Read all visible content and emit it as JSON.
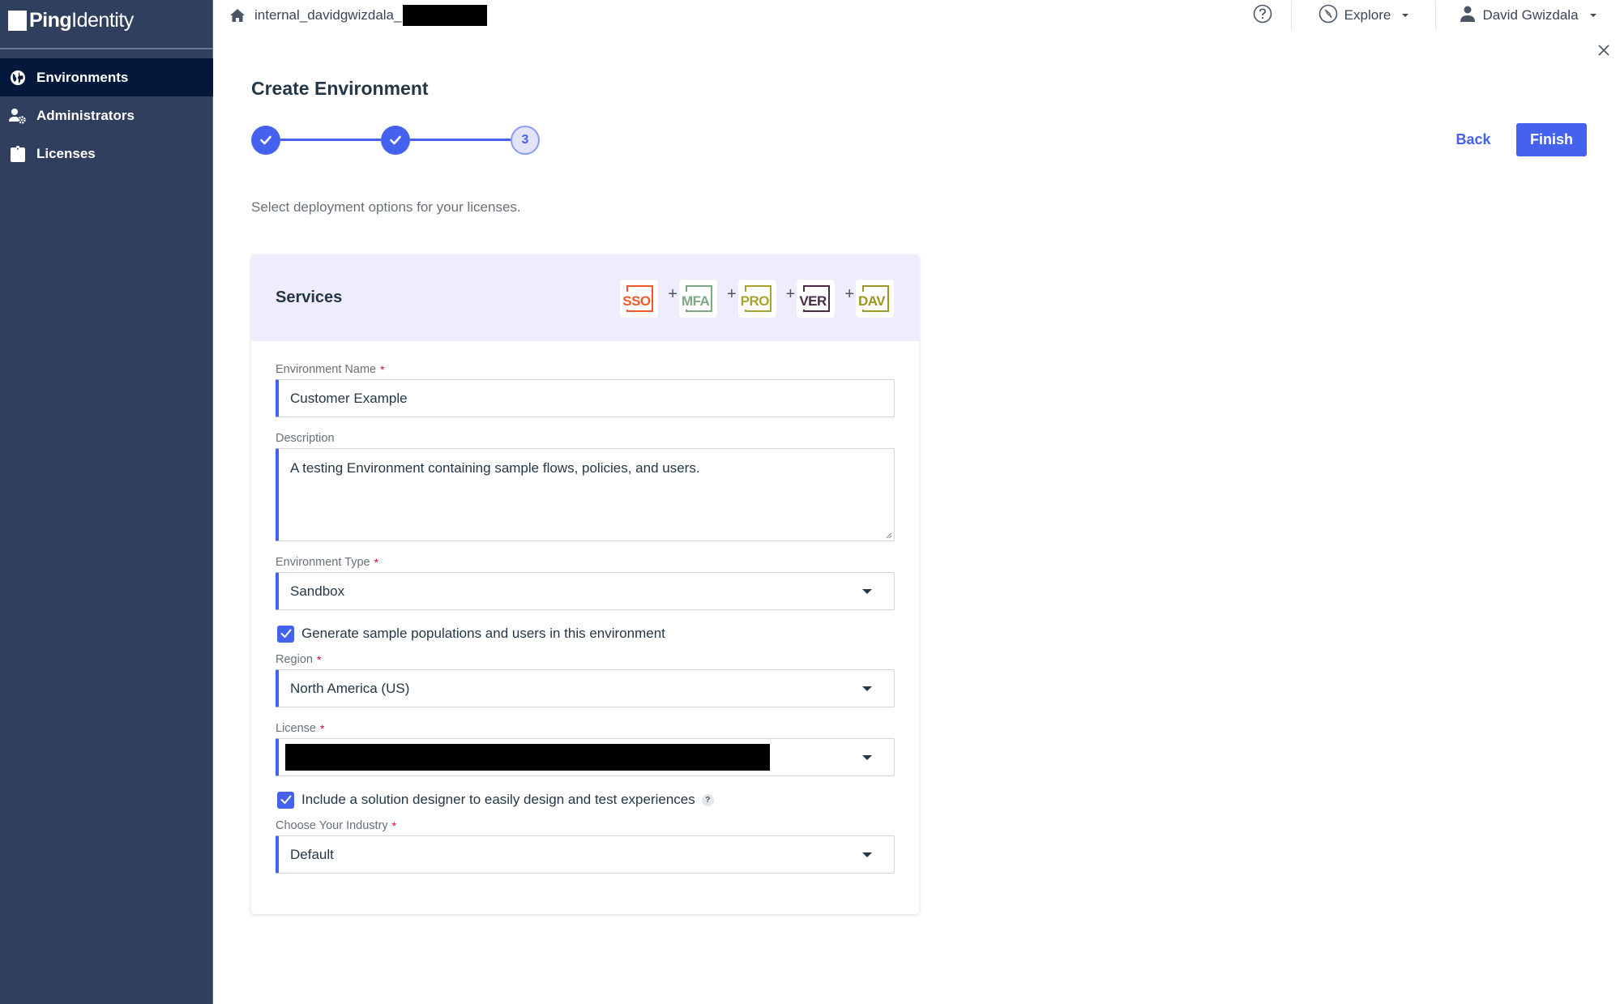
{
  "brand": {
    "logo_bold": "Ping",
    "logo_light": "Identity"
  },
  "sidebar": {
    "items": [
      {
        "label": "Environments",
        "icon": "globe-icon",
        "active": true
      },
      {
        "label": "Administrators",
        "icon": "user-gear-icon",
        "active": false
      },
      {
        "label": "Licenses",
        "icon": "clipboard-icon",
        "active": false
      }
    ]
  },
  "topbar": {
    "breadcrumb": "internal_davidgwizdala_",
    "explore_label": "Explore",
    "user_name": "David Gwizdala"
  },
  "page": {
    "title": "Create Environment",
    "subtitle": "Select deployment options for your licenses.",
    "stepper": {
      "total_steps": 3,
      "current_step": 3,
      "completed_steps": 2,
      "current_label": "3"
    },
    "back_label": "Back",
    "finish_label": "Finish"
  },
  "services": {
    "title": "Services",
    "badges": [
      {
        "label": "SSO",
        "color": "#f05a28"
      },
      {
        "label": "MFA",
        "color": "#7fa785"
      },
      {
        "label": "PRO",
        "color": "#a9a130"
      },
      {
        "label": "VER",
        "color": "#4a2a45"
      },
      {
        "label": "DAV",
        "color": "#9b9726"
      }
    ],
    "plus_sign": "+"
  },
  "form": {
    "env_name": {
      "label": "Environment Name",
      "required": "*",
      "value": "Customer Example"
    },
    "description": {
      "label": "Description",
      "value": "A testing Environment containing sample flows, policies, and users."
    },
    "env_type": {
      "label": "Environment Type",
      "required": "*",
      "value": "Sandbox"
    },
    "sample_users": {
      "label": "Generate sample populations and users in this environment",
      "checked": true
    },
    "region": {
      "label": "Region",
      "required": "*",
      "value": "North America (US)"
    },
    "license": {
      "label": "License",
      "required": "*",
      "value": "[redacted]"
    },
    "solution_designer": {
      "label": "Include a solution designer to easily design and test experiences",
      "checked": true,
      "help": "?"
    },
    "industry": {
      "label": "Choose Your Industry",
      "required": "*",
      "value": "Default"
    }
  },
  "colors": {
    "accent": "#4462ed",
    "sidebar_bg": "#313f5f",
    "sidebar_active": "#03183a",
    "card_header_bg": "#eeecfd",
    "required": "#c8102e"
  }
}
